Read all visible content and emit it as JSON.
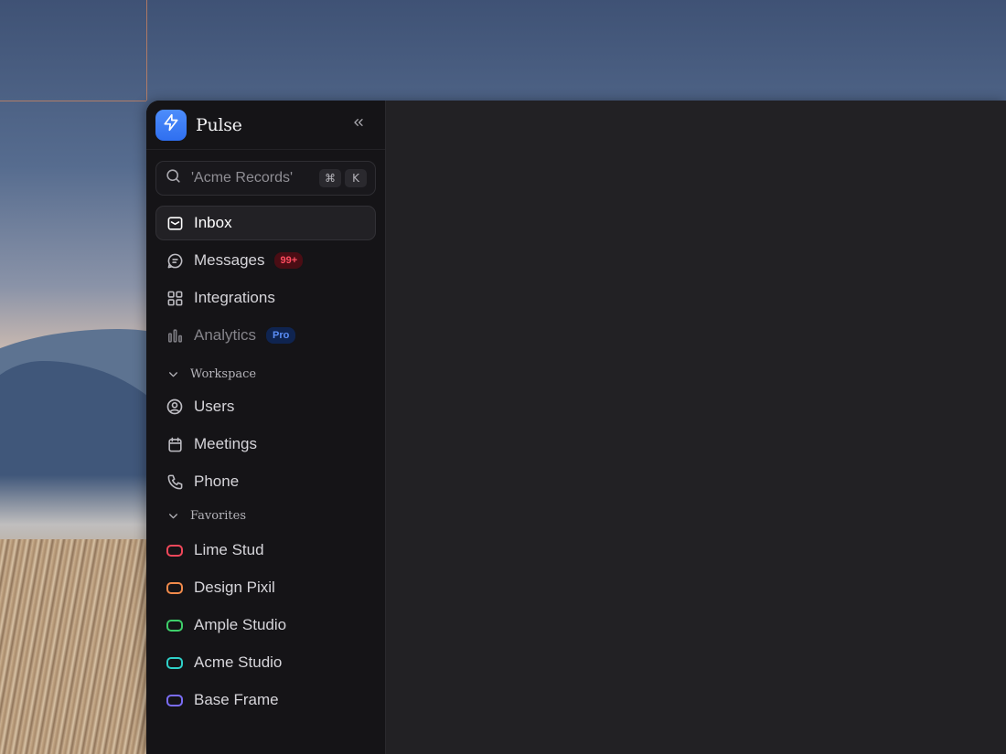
{
  "app": {
    "name": "Pulse",
    "accent": "#3b7cf6"
  },
  "search": {
    "placeholder": "'Acme Records'",
    "shortcut_mod": "⌘",
    "shortcut_key": "K"
  },
  "nav": [
    {
      "label": "Inbox",
      "icon": "inbox-icon",
      "active": true
    },
    {
      "label": "Messages",
      "icon": "message-icon",
      "badge": "99+",
      "badge_color": "#ff4c5f"
    },
    {
      "label": "Integrations",
      "icon": "grid-icon"
    },
    {
      "label": "Analytics",
      "icon": "bar-chart-icon",
      "badge": "Pro",
      "badge_color": "#5b8ef7",
      "muted": true
    }
  ],
  "workspace": {
    "title": "Workspace",
    "items": [
      {
        "label": "Users",
        "icon": "user-circle-icon"
      },
      {
        "label": "Meetings",
        "icon": "calendar-icon"
      },
      {
        "label": "Phone",
        "icon": "phone-icon"
      }
    ]
  },
  "favorites": {
    "title": "Favorites",
    "items": [
      {
        "label": "Lime Stud",
        "color": "#f0475a"
      },
      {
        "label": "Design Pixil",
        "color": "#f08a4b"
      },
      {
        "label": "Ample Studio",
        "color": "#3ecf6a"
      },
      {
        "label": "Acme Studio",
        "color": "#2fd0c8"
      },
      {
        "label": "Base Frame",
        "color": "#7a6cf5"
      }
    ]
  }
}
